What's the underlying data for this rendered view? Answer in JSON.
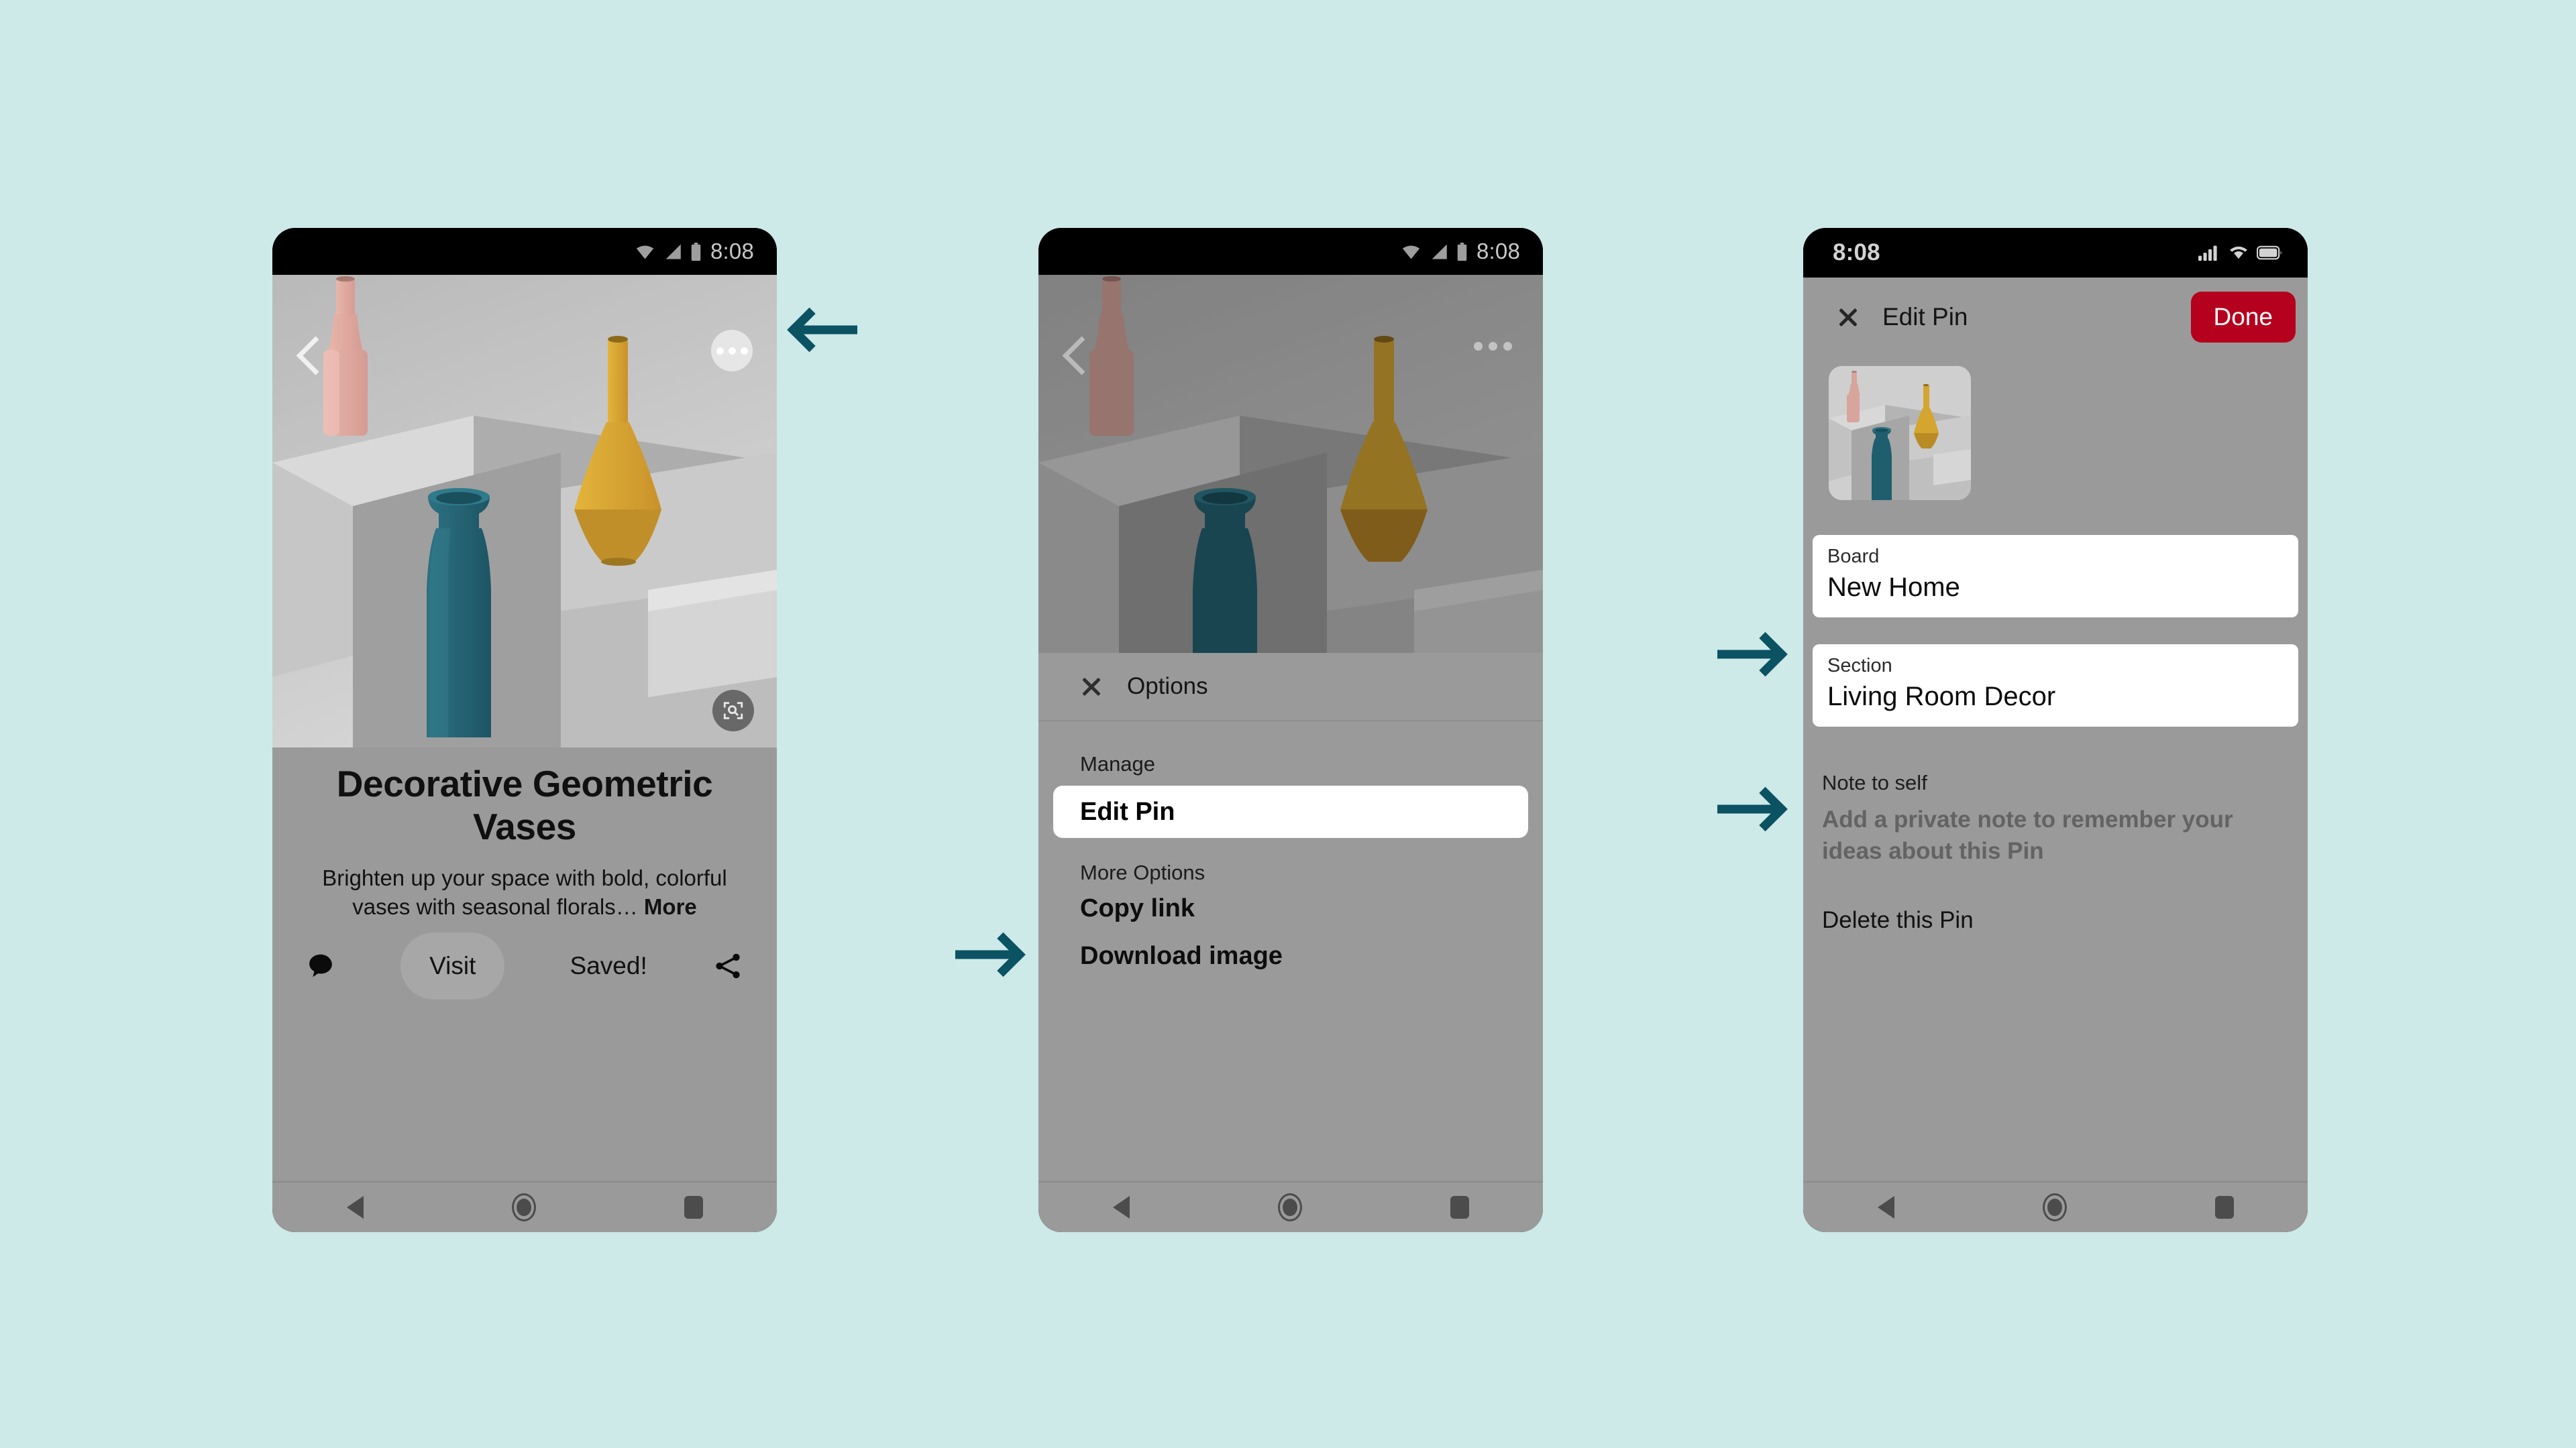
{
  "background_color": "#cde9e8",
  "accent_arrow_color": "#0b5263",
  "brand_red": "#b5001e",
  "phone1": {
    "status_bar": {
      "time": "8:08",
      "icons": [
        "wifi-icon",
        "signal-icon",
        "battery-icon"
      ]
    },
    "image_overlay": {
      "back_icon": "back-chevron-icon",
      "more_icon": "more-options-icon",
      "lens_icon": "visual-search-icon"
    },
    "title": "Decorative Geometric Vases",
    "description": "Brighten up your space with bold, colorful vases with seasonal florals…",
    "description_more": "More",
    "actions": {
      "comment_icon": "comment-icon",
      "visit_label": "Visit",
      "saved_label": "Saved!",
      "share_icon": "share-icon"
    },
    "nav_bar": [
      "nav-back-icon",
      "nav-home-icon",
      "nav-recents-icon"
    ]
  },
  "phone2": {
    "status_bar": {
      "time": "8:08",
      "icons": [
        "wifi-icon",
        "signal-icon",
        "battery-icon"
      ]
    },
    "image_overlay": {
      "back_icon": "back-chevron-icon",
      "more_icon": "more-options-icon"
    },
    "sheet": {
      "close_icon": "close-icon",
      "title": "Options",
      "group_manage_label": "Manage",
      "manage_items": [
        "Edit Pin"
      ],
      "group_more_label": "More Options",
      "more_items": [
        "Copy link",
        "Download image"
      ]
    },
    "nav_bar": [
      "nav-back-icon",
      "nav-home-icon",
      "nav-recents-icon"
    ]
  },
  "phone3": {
    "status_bar": {
      "time": "8:08",
      "icons": [
        "signal-icon",
        "wifi-icon",
        "battery-icon"
      ]
    },
    "header": {
      "close_icon": "close-icon",
      "title": "Edit Pin",
      "done_label": "Done"
    },
    "thumbnail_alt": "pin-thumbnail",
    "fields": [
      {
        "label": "Board",
        "value": "New Home"
      },
      {
        "label": "Section",
        "value": "Living Room Decor"
      }
    ],
    "note": {
      "label": "Note to self",
      "placeholder": "Add a private note to remember your ideas about this Pin"
    },
    "delete_label": "Delete this Pin",
    "nav_bar": [
      "nav-back-icon",
      "nav-home-icon",
      "nav-recents-icon"
    ]
  },
  "annotations": [
    {
      "name": "arrow-to-more-options",
      "direction": "left"
    },
    {
      "name": "arrow-to-edit-pin",
      "direction": "right"
    },
    {
      "name": "arrow-to-board-field",
      "direction": "right"
    },
    {
      "name": "arrow-to-section-field",
      "direction": "right"
    }
  ]
}
